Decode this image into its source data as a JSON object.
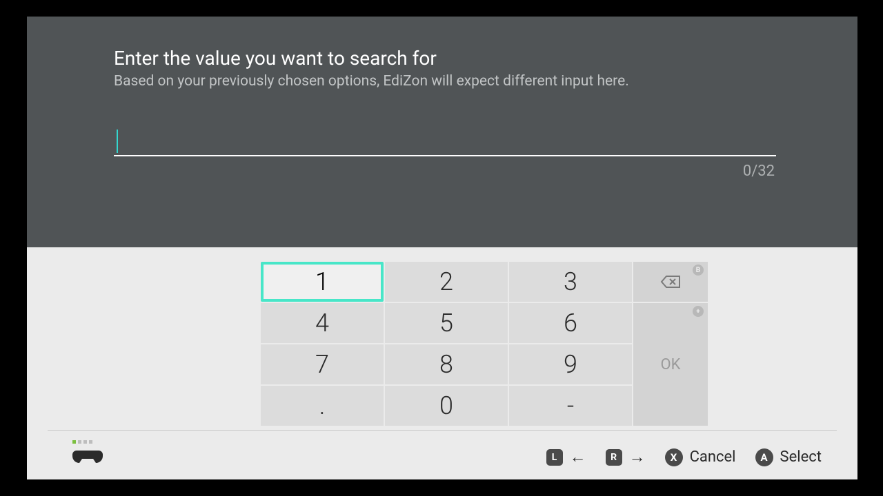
{
  "header": {
    "title": "Enter the value you want to search for",
    "subtitle": "Based on your previously chosen options, EdiZon will expect different input here."
  },
  "input": {
    "value": "",
    "counter": "0/32"
  },
  "keypad": {
    "rows": [
      [
        "1",
        "2",
        "3"
      ],
      [
        "4",
        "5",
        "6"
      ],
      [
        "7",
        "8",
        "9"
      ],
      [
        ".",
        "0",
        "-"
      ]
    ],
    "ok_label": "OK",
    "backspace_hint": "B",
    "ok_hint": "+",
    "selected_key": "1"
  },
  "footer": {
    "l_badge": "L",
    "r_badge": "R",
    "cancel_badge": "X",
    "cancel_label": "Cancel",
    "select_badge": "A",
    "select_label": "Select"
  }
}
